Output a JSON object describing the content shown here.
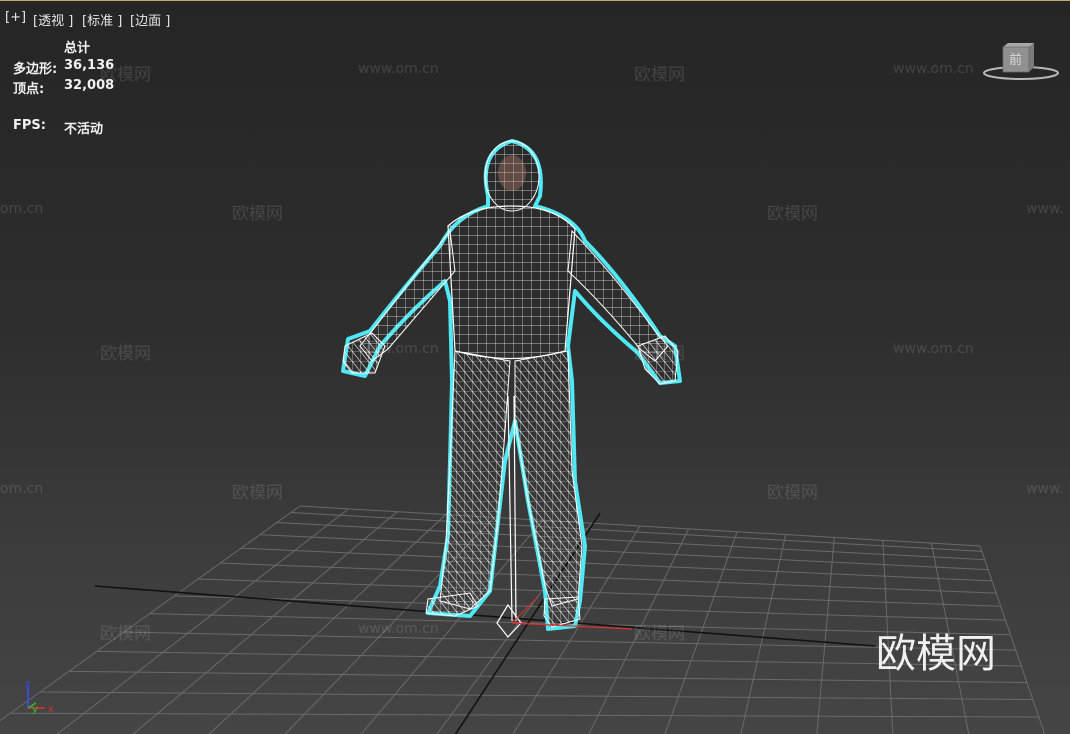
{
  "viewport_labels": {
    "plus": "[+]",
    "view": "[透视 ]",
    "shading": "[标准 ]",
    "mode": "[边面 ]"
  },
  "stats": {
    "header": "总计",
    "polys_label": "多边形:",
    "polys_value": "36,136",
    "verts_label": "顶点:",
    "verts_value": "32,008",
    "fps_label": "FPS:",
    "fps_value": "不活动"
  },
  "viewcube": {
    "face_label": "前"
  },
  "axis_tripod": {
    "z": "z",
    "y": "y",
    "x": "x"
  },
  "watermarks": {
    "brand": "欧模网",
    "url": "www.om.cn",
    "url_partial_left": "om.cn",
    "url_partial_right": "www."
  },
  "colors": {
    "selection_outline": "#4fe8f5",
    "wireframe": "#ffffff",
    "grid": "#6a6a6a",
    "axis_x": "#e03030",
    "axis_z": "#3050ff"
  }
}
